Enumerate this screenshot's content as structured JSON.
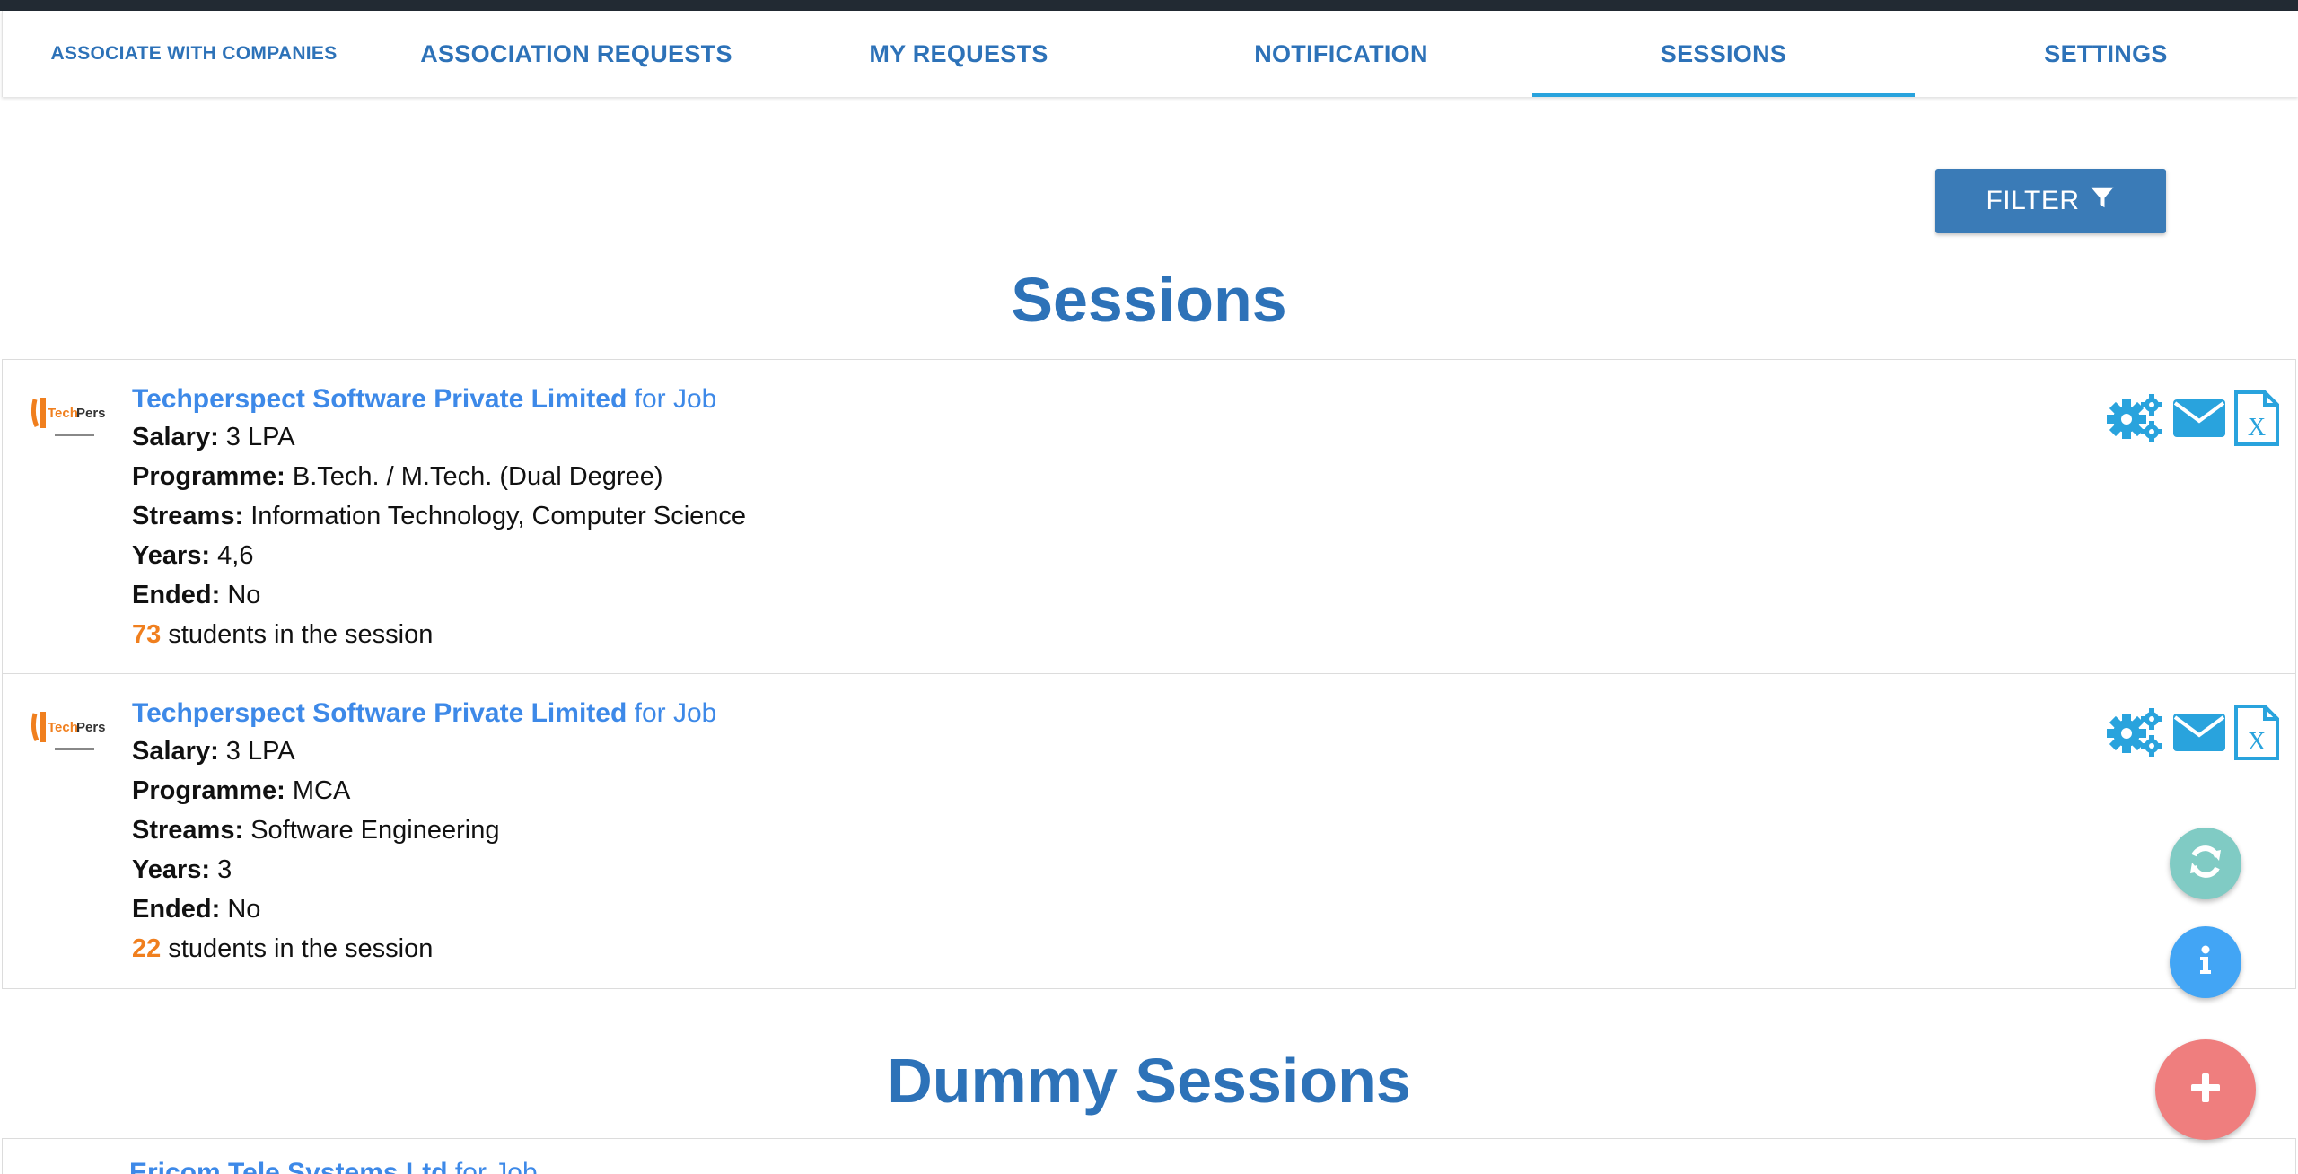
{
  "tabs": [
    {
      "label": "ASSOCIATE WITH COMPANIES",
      "active": false
    },
    {
      "label": "ASSOCIATION REQUESTS",
      "active": false
    },
    {
      "label": "MY REQUESTS",
      "active": false
    },
    {
      "label": "NOTIFICATION",
      "active": false
    },
    {
      "label": "SESSIONS",
      "active": true
    },
    {
      "label": "SETTINGS",
      "active": false
    }
  ],
  "filter": {
    "label": "FILTER",
    "icon": "filter-icon"
  },
  "sessions": {
    "title": "Sessions",
    "items": [
      {
        "company": "Techperspect Software Private Limited",
        "for_text": "for Job",
        "salary_label": "Salary:",
        "salary": "3 LPA",
        "programme_label": "Programme:",
        "programme": "B.Tech. / M.Tech. (Dual Degree)",
        "streams_label": "Streams:",
        "streams": "Information Technology, Computer Science",
        "years_label": "Years:",
        "years": "4,6",
        "ended_label": "Ended:",
        "ended": "No",
        "students": "73",
        "students_suffix": "students in the session"
      },
      {
        "company": "Techperspect Software Private Limited",
        "for_text": "for Job",
        "salary_label": "Salary:",
        "salary": "3 LPA",
        "programme_label": "Programme:",
        "programme": "MCA",
        "streams_label": "Streams:",
        "streams": "Software Engineering",
        "years_label": "Years:",
        "years": "3",
        "ended_label": "Ended:",
        "ended": "No",
        "students": "22",
        "students_suffix": "students in the session"
      }
    ]
  },
  "dummy_sessions": {
    "title": "Dummy Sessions",
    "items": [
      {
        "company": "Ericom Tele Systems Ltd",
        "for_text": "for Job"
      }
    ]
  },
  "fabs": {
    "refresh": "refresh-icon",
    "info": "info-icon",
    "add": "plus-icon"
  },
  "colors": {
    "brand_blue": "#2d72b8",
    "link_blue": "#3d89e8",
    "tab_indicator": "#29a3dd",
    "count_orange": "#f07f1e",
    "action_blue": "#29a3dd",
    "fab_refresh": "#80cbc4",
    "fab_info": "#42a5f5",
    "fab_add": "#ef7e7e"
  }
}
